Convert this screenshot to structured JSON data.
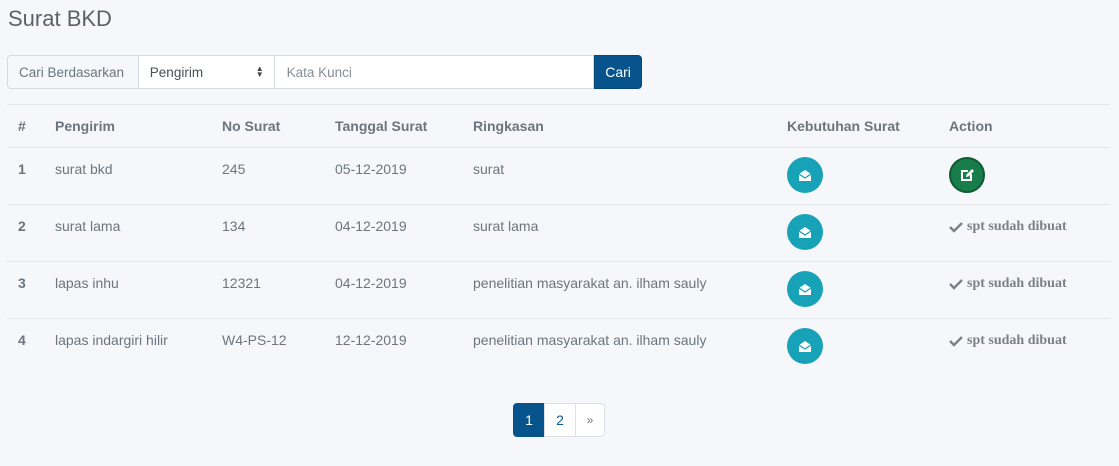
{
  "page": {
    "title": "Surat BKD"
  },
  "search": {
    "label": "Cari Berdasarkan",
    "selected": "Pengirim",
    "placeholder": "Kata Kunci",
    "button": "Cari"
  },
  "table": {
    "headers": [
      "#",
      "Pengirim",
      "No Surat",
      "Tanggal Surat",
      "Ringkasan",
      "Kebutuhan Surat",
      "Action"
    ],
    "rows": [
      {
        "no": "1",
        "pengirim": "surat bkd",
        "no_surat": "245",
        "tanggal": "05-12-2019",
        "ringkasan": "surat",
        "action": "edit"
      },
      {
        "no": "2",
        "pengirim": "surat lama",
        "no_surat": "134",
        "tanggal": "04-12-2019",
        "ringkasan": "surat lama",
        "action": "spt sudah dibuat"
      },
      {
        "no": "3",
        "pengirim": "lapas inhu",
        "no_surat": "12321",
        "tanggal": "04-12-2019",
        "ringkasan": "penelitian masyarakat an. ilham sauly",
        "action": "spt sudah dibuat"
      },
      {
        "no": "4",
        "pengirim": "lapas indargiri hilir",
        "no_surat": "W4-PS-12",
        "tanggal": "12-12-2019",
        "ringkasan": "penelitian masyarakat an. ilham sauly",
        "action": "spt sudah dibuat"
      }
    ]
  },
  "pagination": {
    "pages": [
      "1",
      "2"
    ],
    "next": "»",
    "current": "1"
  },
  "icons": {
    "envelope": "envelope-open-icon",
    "edit": "edit-icon",
    "check": "check-icon"
  },
  "colors": {
    "primary": "#07548d",
    "teal": "#17a2b8",
    "green": "#187d4a"
  }
}
